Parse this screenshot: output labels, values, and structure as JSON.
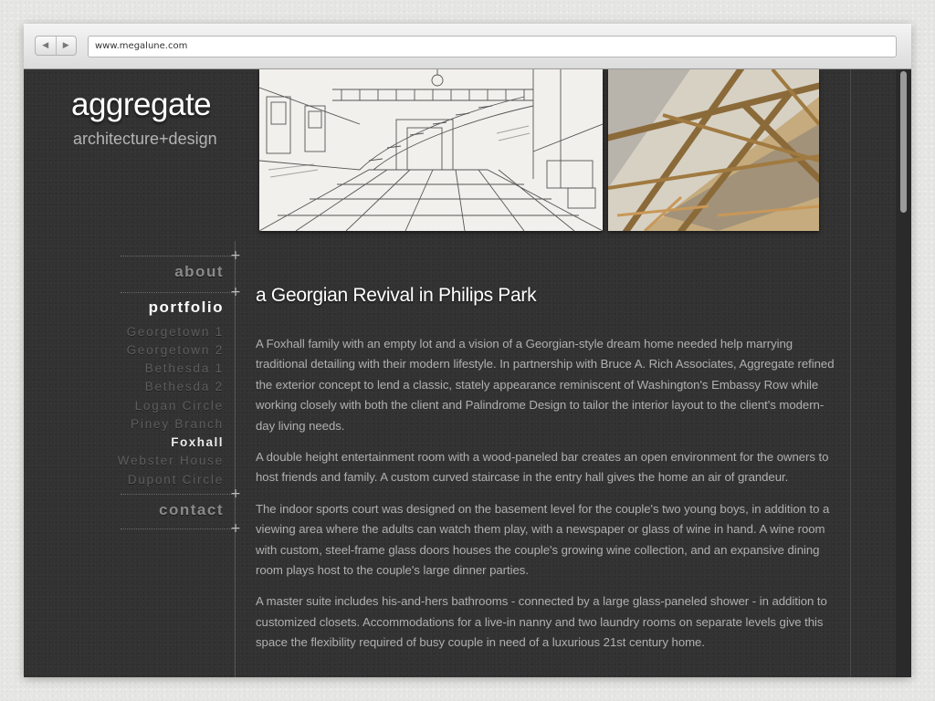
{
  "browser": {
    "back_label": "◀",
    "forward_label": "▶",
    "url": "www.megalune.com"
  },
  "site": {
    "logo_word": "aggregate",
    "logo_tagline": "architecture+design"
  },
  "nav": {
    "about": "about",
    "portfolio": "portfolio",
    "contact": "contact",
    "plus": "+",
    "portfolio_items": [
      "Georgetown 1",
      "Georgetown 2",
      "Bethesda 1",
      "Bethesda 2",
      "Logan Circle",
      "Piney Branch",
      "Foxhall",
      "Webster House",
      "Dupont Circle"
    ],
    "current_item": "Foxhall"
  },
  "article": {
    "title": "a Georgian Revival in Philips Park",
    "paragraphs": [
      "A Foxhall family with an empty lot and a vision of a Georgian-style dream home needed help marrying traditional detailing with their modern lifestyle. In partnership with Bruce A. Rich Associates, Aggregate refined the exterior concept to lend a classic, stately appearance reminiscent of Washington's Embassy Row while working closely with both the client and Palindrome Design to tailor the interior layout to the client's modern-day living needs.",
      "A double height entertainment room with a wood-paneled bar creates an open environment for the owners to host friends and family. A custom curved staircase in the entry hall gives the home an air of grandeur.",
      "The indoor sports court was designed on the basement level for the couple's two young boys, in addition to a viewing area where the adults can watch them play, with a newspaper or glass of wine in hand. A wine room with custom, steel-frame glass doors houses the couple's growing wine collection, and an expansive dining room plays host to the couple's large dinner parties.",
      "A master suite includes his-and-hers bathrooms - connected by a large glass-paneled shower - in addition to customized closets. Accommodations for a live-in nanny and two laundry rooms on separate levels give this space the flexibility required of busy couple in need of a luxurious 21st century home."
    ]
  },
  "colors": {
    "page_bg": "#323232",
    "nav_active": "#ffffff",
    "nav_inactive": "#5d5d5d",
    "body_text": "#b0b0b0"
  }
}
